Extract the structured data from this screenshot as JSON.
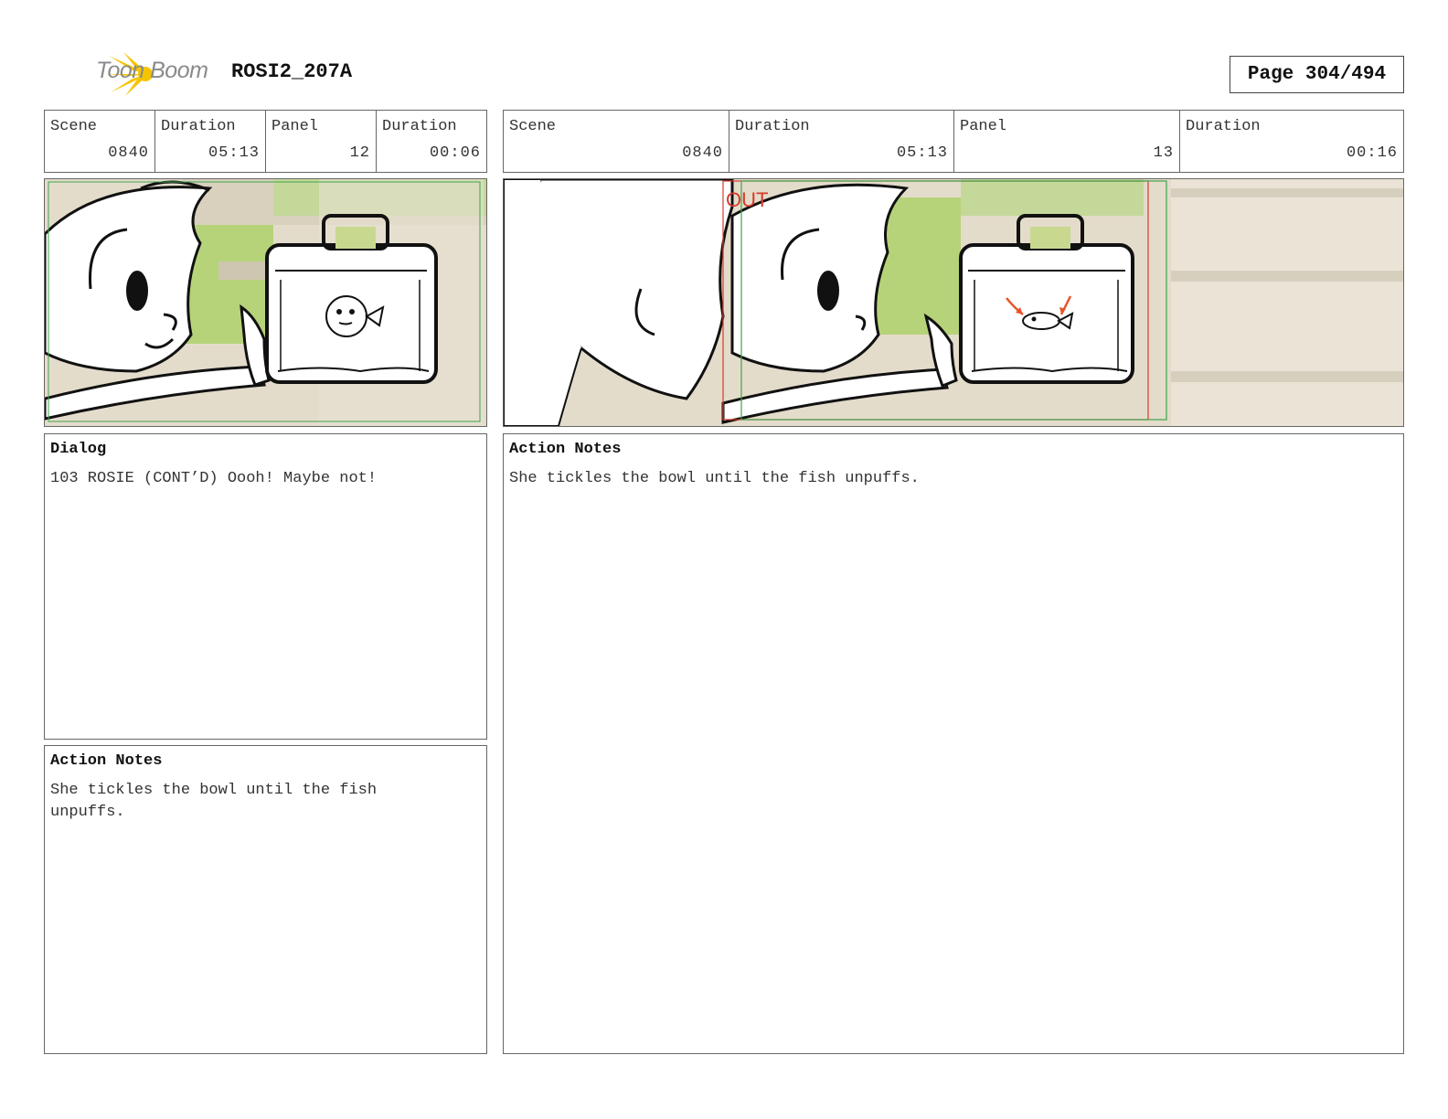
{
  "header": {
    "logo_text": "Toon Boom",
    "project": "ROSI2_207A",
    "page": "Page 304/494"
  },
  "panel_left": {
    "scene_label": "Scene",
    "scene": "0840",
    "duration_label": "Duration",
    "duration": "05:13",
    "panel_label": "Panel",
    "panel": "12",
    "panel_duration_label": "Duration",
    "panel_duration": "00:06",
    "dialog_label": "Dialog",
    "dialog": "103 ROSIE (CONT’D) Oooh! Maybe not!",
    "notes_label": "Action Notes",
    "notes": "She tickles the bowl until the fish\nunpuffs."
  },
  "panel_right": {
    "scene_label": "Scene",
    "scene": "0840",
    "duration_label": "Duration",
    "duration": "05:13",
    "panel_label": "Panel",
    "panel": "13",
    "panel_duration_label": "Duration",
    "panel_duration": "00:16",
    "notes_label": "Action Notes",
    "notes": "She tickles the bowl until the fish unpuffs.",
    "camera_tag": "OUT"
  },
  "colors": {
    "logo_star": "#f5c400",
    "bg_green": "#b7d37a",
    "bg_wall": "#e4dccb",
    "camera_red": "#d83a2a",
    "camera_green": "#3fa34d",
    "arrow_orange": "#e8552a"
  }
}
